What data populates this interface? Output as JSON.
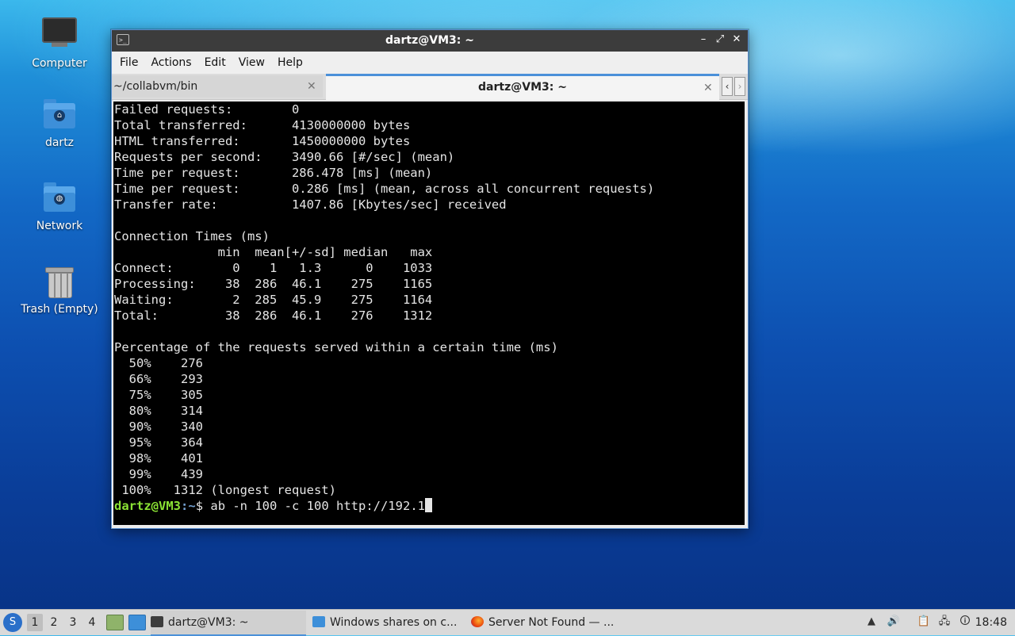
{
  "desktop": {
    "icons": [
      {
        "label": "Computer"
      },
      {
        "label": "dartz"
      },
      {
        "label": "Network"
      },
      {
        "label": "Trash (Empty)"
      }
    ]
  },
  "window": {
    "title": "dartz@VM3: ~",
    "term_icon": ">_",
    "controls": {
      "minimize": "–",
      "maximize": "⤢",
      "close": "✕"
    },
    "menu": [
      "File",
      "Actions",
      "Edit",
      "View",
      "Help"
    ],
    "tabs": [
      {
        "label": "~/collabvm/bin",
        "close": "✕"
      },
      {
        "label": "dartz@VM3: ~",
        "close": "✕"
      }
    ],
    "tab_nav": {
      "prev": "‹",
      "next": "›"
    }
  },
  "terminal": {
    "lines": [
      "Failed requests:        0",
      "Total transferred:      4130000000 bytes",
      "HTML transferred:       1450000000 bytes",
      "Requests per second:    3490.66 [#/sec] (mean)",
      "Time per request:       286.478 [ms] (mean)",
      "Time per request:       0.286 [ms] (mean, across all concurrent requests)",
      "Transfer rate:          1407.86 [Kbytes/sec] received",
      "",
      "Connection Times (ms)",
      "              min  mean[+/-sd] median   max",
      "Connect:        0    1   1.3      0    1033",
      "Processing:    38  286  46.1    275    1165",
      "Waiting:        2  285  45.9    275    1164",
      "Total:         38  286  46.1    276    1312",
      "",
      "Percentage of the requests served within a certain time (ms)",
      "  50%    276",
      "  66%    293",
      "  75%    305",
      "  80%    314",
      "  90%    340",
      "  95%    364",
      "  98%    401",
      "  99%    439",
      " 100%   1312 (longest request)"
    ],
    "prompt": {
      "user_host": "dartz@VM3",
      "colon": ":",
      "path": "~",
      "dollar": "$ ",
      "command": "ab -n 100 -c 100 http://192.1"
    }
  },
  "taskbar": {
    "start_icon": "S",
    "workspaces": [
      "1",
      "2",
      "3",
      "4"
    ],
    "tasks": [
      {
        "label": "dartz@VM3: ~"
      },
      {
        "label": "Windows shares on c..."
      },
      {
        "label": "Server Not Found — ..."
      }
    ],
    "clock": "18:48"
  }
}
